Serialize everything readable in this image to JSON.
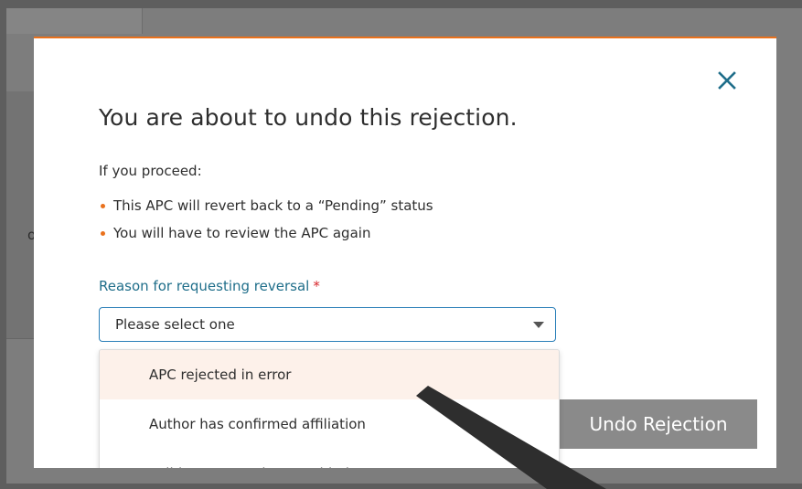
{
  "background": {
    "partial_text": "ol"
  },
  "modal": {
    "title": "You are about to undo this rejection.",
    "intro": "If you proceed:",
    "bullets": [
      "This APC will revert back to a “Pending” status",
      "You will have to review the APC again"
    ],
    "close_icon": "close-icon"
  },
  "reason_field": {
    "label": "Reason for requesting reversal",
    "required_marker": "*",
    "selected_value": "Please select one",
    "options": [
      "APC rejected in error",
      "Author has confirmed affiliation",
      "Valid Grant Number provided"
    ]
  },
  "actions": {
    "undo_label": "Undo Rejection"
  },
  "colors": {
    "accent_orange": "#e9711c",
    "label_teal": "#1f6e8a",
    "required_red": "#d7262b",
    "select_border_blue": "#2a7fb8",
    "button_gray": "#8a8a8a",
    "highlight_option": "#fdf1ea",
    "overlay": "#5e5e5e"
  }
}
